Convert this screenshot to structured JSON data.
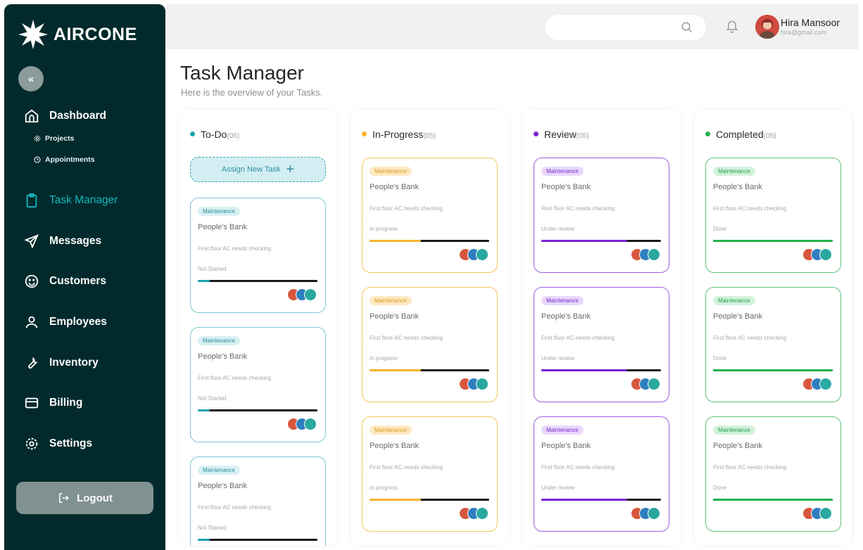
{
  "brand": {
    "name": "AIRCONE"
  },
  "sidebar": {
    "collapse_label": "«",
    "items": [
      {
        "label": "Dashboard",
        "icon": "home-icon"
      },
      {
        "label": "Task Manager",
        "icon": "clipboard-icon",
        "active": true
      },
      {
        "label": "Messages",
        "icon": "send-icon"
      },
      {
        "label": "Customers",
        "icon": "smile-icon"
      },
      {
        "label": "Employees",
        "icon": "user-icon"
      },
      {
        "label": "Inventory",
        "icon": "wrench-icon"
      },
      {
        "label": "Billing",
        "icon": "card-icon"
      },
      {
        "label": "Settings",
        "icon": "gear-icon"
      }
    ],
    "sub_items": [
      {
        "label": "Projects",
        "icon": "gear-small-icon"
      },
      {
        "label": "Appointments",
        "icon": "clock-icon"
      }
    ],
    "logout_label": "Logout"
  },
  "header": {
    "search_placeholder": "",
    "user": {
      "name": "Hira Mansoor",
      "email": "hira@gmail.com"
    }
  },
  "page": {
    "title": "Task Manager",
    "subtitle": "Here is the overview of your Tasks."
  },
  "assign_label": "Assign New Task",
  "colors": {
    "todo": "#1aa3ad",
    "inprogress": "#f5b52e",
    "review": "#7c22d6",
    "completed": "#22b04b"
  },
  "columns": [
    {
      "name": "To-Do",
      "count": "(05)",
      "cards": [
        {
          "tag": "Maintenance",
          "title": "People's Bank",
          "desc": "First floor AC needs checking",
          "status": "Not Started",
          "progress": 0.1
        },
        {
          "tag": "Maintenance",
          "title": "People's Bank",
          "desc": "First floor AC needs checking",
          "status": "Not Started",
          "progress": 0.1
        },
        {
          "tag": "Maintenance",
          "title": "People's Bank",
          "desc": "First floor AC needs checking",
          "status": "Not Started",
          "progress": 0.1
        }
      ]
    },
    {
      "name": "In-Progress",
      "count": "(05)",
      "cards": [
        {
          "tag": "Maintenance",
          "title": "People's Bank",
          "desc": "First floor AC needs checking",
          "status": "In progress",
          "progress": 0.43
        },
        {
          "tag": "Maintenance",
          "title": "People's Bank",
          "desc": "First floor AC needs checking",
          "status": "In progress",
          "progress": 0.43
        },
        {
          "tag": "Maintenance",
          "title": "People's Bank",
          "desc": "First floor AC needs checking",
          "status": "In progress",
          "progress": 0.43
        }
      ]
    },
    {
      "name": "Review",
      "count": "(05)",
      "cards": [
        {
          "tag": "Maintenance",
          "title": "People's Bank",
          "desc": "First floor AC needs checking",
          "status": "Under review",
          "progress": 0.72
        },
        {
          "tag": "Maintenance",
          "title": "People's Bank",
          "desc": "First floor AC needs checking",
          "status": "Under review",
          "progress": 0.72
        },
        {
          "tag": "Maintenance",
          "title": "People's Bank",
          "desc": "First floor AC needs checking",
          "status": "Under review",
          "progress": 0.72
        }
      ]
    },
    {
      "name": "Completed",
      "count": "(05)",
      "cards": [
        {
          "tag": "Maintenance",
          "title": "People's Bank",
          "desc": "First floor AC needs checking",
          "status": "Done",
          "progress": 1.0
        },
        {
          "tag": "Maintenance",
          "title": "People's Bank",
          "desc": "First floor AC needs checking",
          "status": "Done",
          "progress": 1.0
        },
        {
          "tag": "Maintenance",
          "title": "People's Bank",
          "desc": "First floor AC needs checking",
          "status": "Done",
          "progress": 1.0
        }
      ]
    }
  ]
}
